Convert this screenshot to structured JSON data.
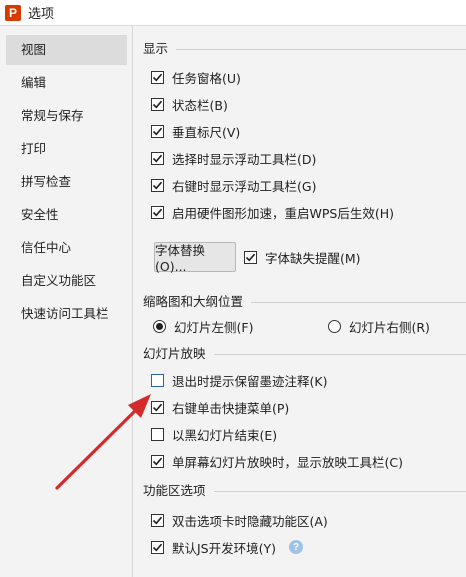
{
  "window": {
    "title": "选项",
    "logo_letter": "P"
  },
  "sidebar": {
    "items": [
      {
        "label": "视图",
        "active": true
      },
      {
        "label": "编辑"
      },
      {
        "label": "常规与保存"
      },
      {
        "label": "打印"
      },
      {
        "label": "拼写检查"
      },
      {
        "label": "安全性"
      },
      {
        "label": "信任中心"
      },
      {
        "label": "自定义功能区"
      },
      {
        "label": "快速访问工具栏"
      }
    ]
  },
  "display": {
    "header": "显示",
    "task_pane": {
      "label": "任务窗格(U)",
      "checked": true
    },
    "status_bar": {
      "label": "状态栏(B)",
      "checked": true
    },
    "vertical_ruler": {
      "label": "垂直标尺(V)",
      "checked": true
    },
    "float_toolbar_on_select": {
      "label": "选择时显示浮动工具栏(D)",
      "checked": true
    },
    "float_toolbar_on_right_click": {
      "label": "右键时显示浮动工具栏(G)",
      "checked": true
    },
    "hardware_acceleration": {
      "label": "启用硬件图形加速，重启WPS后生效(H)",
      "checked": true
    },
    "font_replace_button": "字体替换(O)...",
    "font_missing_warning": {
      "label": "字体缺失提醒(M)",
      "checked": true
    }
  },
  "thumbnail": {
    "header": "缩略图和大纲位置",
    "left": {
      "label": "幻灯片左侧(F)",
      "selected": true
    },
    "right": {
      "label": "幻灯片右侧(R)",
      "selected": false
    }
  },
  "slideshow": {
    "header": "幻灯片放映",
    "prompt_keep_ink": {
      "label": "退出时提示保留墨迹注释(K)",
      "checked": false
    },
    "right_click_menu": {
      "label": "右键单击快捷菜单(P)",
      "checked": true
    },
    "end_with_black": {
      "label": "以黑幻灯片结束(E)",
      "checked": false
    },
    "show_toolbar_single_screen": {
      "label": "单屏幕幻灯片放映时，显示放映工具栏(C)",
      "checked": true
    }
  },
  "ribbon": {
    "header": "功能区选项",
    "hide_on_double_click": {
      "label": "双击选项卡时隐藏功能区(A)",
      "checked": true
    },
    "default_js_env": {
      "label": "默认JS开发环境(Y)",
      "checked": true
    },
    "help_icon": "question-mark"
  },
  "colors": {
    "accent": "#d83b01",
    "annotation_arrow": "#d42a2a",
    "help_icon": "#9fc3e8"
  }
}
